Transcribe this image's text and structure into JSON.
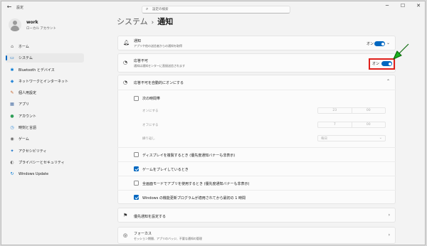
{
  "window": {
    "title": "設定",
    "controls": [
      "─",
      "☐",
      "✕"
    ]
  },
  "profile": {
    "name": "work",
    "subtitle": "ローカル アカウント"
  },
  "search": {
    "placeholder": "設定の検索"
  },
  "nav": {
    "items": [
      {
        "name": "home",
        "label": "ホーム",
        "icon": "⌂",
        "color": "#666666",
        "active": false
      },
      {
        "name": "system",
        "label": "システム",
        "icon": "▭",
        "color": "#0067c0",
        "active": true
      },
      {
        "name": "bluetooth",
        "label": "Bluetooth とデバイス",
        "icon": "✱",
        "color": "#0078d4",
        "active": false
      },
      {
        "name": "network",
        "label": "ネットワークとインターネット",
        "icon": "◆",
        "color": "#2b88d8",
        "active": false
      },
      {
        "name": "personalization",
        "label": "個人用設定",
        "icon": "✎",
        "color": "#c2602a",
        "active": false
      },
      {
        "name": "apps",
        "label": "アプリ",
        "icon": "▦",
        "color": "#4a6fa5",
        "active": false
      },
      {
        "name": "accounts",
        "label": "アカウント",
        "icon": "●",
        "color": "#2e9e57",
        "active": false
      },
      {
        "name": "time-language",
        "label": "時刻と言語",
        "icon": "◷",
        "color": "#2b88d8",
        "active": false
      },
      {
        "name": "gaming",
        "label": "ゲーム",
        "icon": "◉",
        "color": "#666666",
        "active": false
      },
      {
        "name": "accessibility",
        "label": "アクセシビリティ",
        "icon": "✦",
        "color": "#1a73c9",
        "active": false
      },
      {
        "name": "privacy-security",
        "label": "プライバシーとセキュリティ",
        "icon": "◐",
        "color": "#777777",
        "active": false
      },
      {
        "name": "windows-update",
        "label": "Windows Update",
        "icon": "↻",
        "color": "#0078d4",
        "active": false
      }
    ]
  },
  "breadcrumb": {
    "parent": "システム",
    "separator": "›",
    "current": "通知"
  },
  "notifications_card": {
    "title": "通知",
    "description": "アプリや他の送信者からの通知を取得",
    "toggle_label": "オン",
    "toggle_on": true
  },
  "dnd_card": {
    "title": "応答不可",
    "description": "通知は通知センターに直接送信されます",
    "toggle_label": "オン",
    "toggle_on": true
  },
  "auto_dnd": {
    "title": "応答不可を自動的にオンにする",
    "during_time": {
      "label": "次の時間帯",
      "checked": false
    },
    "turn_on": {
      "label": "オンにする",
      "hour": "23",
      "minute": "00"
    },
    "turn_off": {
      "label": "オフにする",
      "hour": "7",
      "minute": "00"
    },
    "repeat": {
      "label": "繰り返し",
      "value": "毎日"
    },
    "options": [
      {
        "label": "ディスプレイを複製するとき (優先度通知バナーも非表示)",
        "checked": false
      },
      {
        "label": "ゲームをプレイしているとき",
        "checked": true
      },
      {
        "label": "全画面モードでアプリを使用するとき (優先度通知バナーも非表示)",
        "checked": false
      },
      {
        "label": "Windows の機能更新プログラムが適用されてから最初の 1 時間",
        "checked": true
      }
    ]
  },
  "priority_card": {
    "title": "優先通知を設定する"
  },
  "focus_card": {
    "title": "フォーカス",
    "description": "セッション期間、アプリのバッジ、不要な通知の管理"
  },
  "annotation": {
    "arrow_color": "#1db31d",
    "box_color": "#e0201b"
  }
}
